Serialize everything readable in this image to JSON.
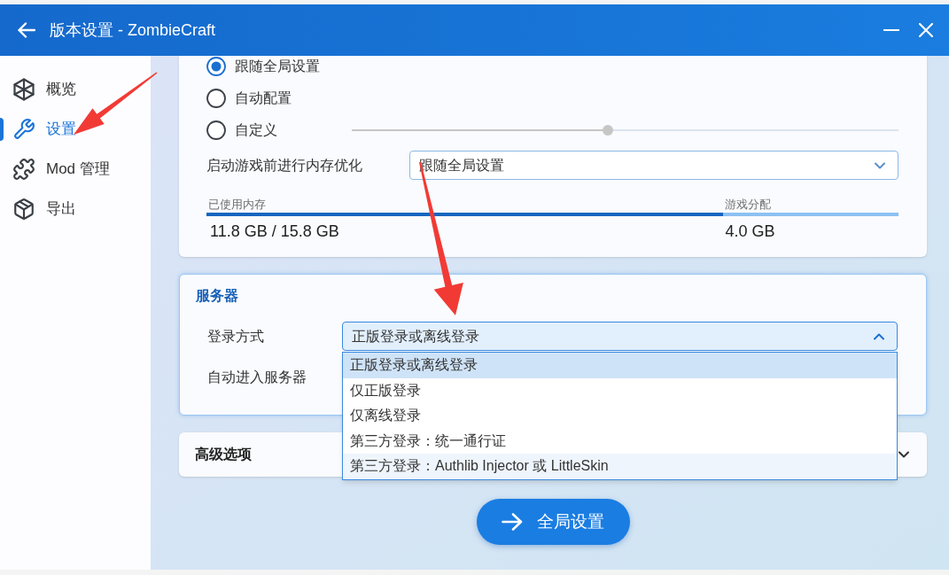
{
  "window": {
    "title": "版本设置 - ZombieCraft"
  },
  "sidebar": {
    "items": [
      {
        "label": "概览",
        "selected": false
      },
      {
        "label": "设置",
        "selected": true
      },
      {
        "label": "Mod 管理",
        "selected": false
      },
      {
        "label": "导出",
        "selected": false
      }
    ]
  },
  "memory_card": {
    "options": [
      {
        "label": "跟随全局设置",
        "selected": true
      },
      {
        "label": "自动配置",
        "selected": false
      },
      {
        "label": "自定义",
        "selected": false,
        "slider": {
          "level": 0.468
        }
      }
    ],
    "optimize": {
      "label": "启动游戏前进行内存优化",
      "value": "跟随全局设置"
    },
    "memory": {
      "used": {
        "label": "已使用内存",
        "value": "11.8 GB / 15.8 GB",
        "level": 0.747
      },
      "allocated": {
        "label": "游戏分配",
        "value": "4.0 GB",
        "level": 0.253
      }
    }
  },
  "server_card": {
    "title": "服务器",
    "login": {
      "label": "登录方式",
      "value": "正版登录或离线登录",
      "expanded": true,
      "options": [
        {
          "label": "正版登录或离线登录",
          "selected": true,
          "hovered": false
        },
        {
          "label": "仅正版登录",
          "selected": false,
          "hovered": false
        },
        {
          "label": "仅离线登录",
          "selected": false,
          "hovered": false
        },
        {
          "label": "第三方登录：统一通行证",
          "selected": false,
          "hovered": false
        },
        {
          "label": "第三方登录：Authlib Injector 或 LittleSkin",
          "selected": false,
          "hovered": true
        }
      ]
    },
    "auto_join": {
      "label": "自动进入服务器"
    }
  },
  "advanced_card": {
    "title": "高级选项",
    "expanded": false
  },
  "global_button": {
    "label": "全局设置"
  }
}
